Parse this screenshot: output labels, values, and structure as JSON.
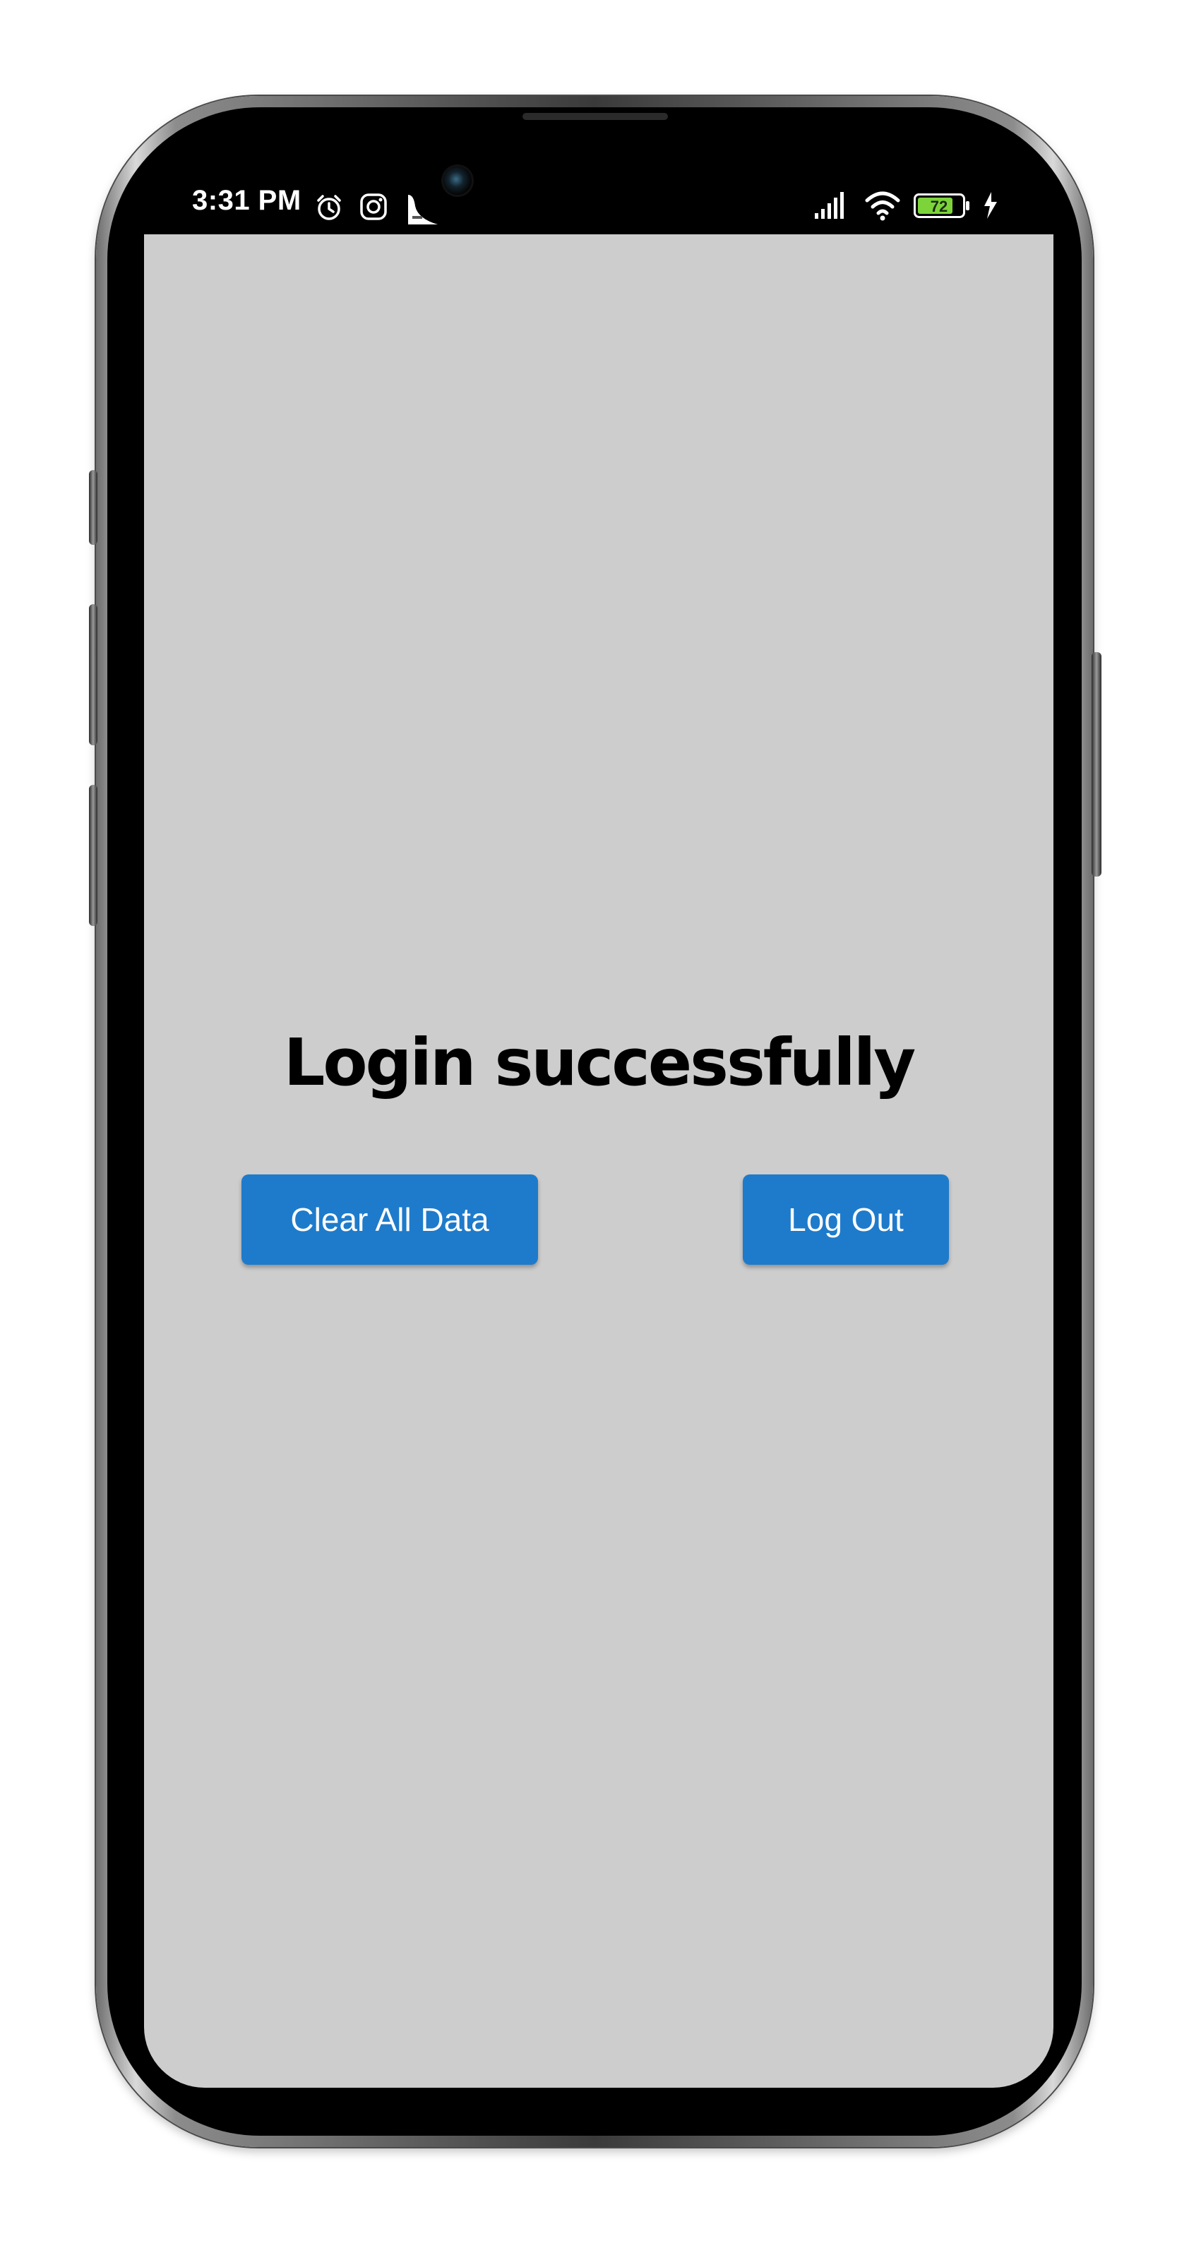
{
  "status_bar": {
    "time": "3:31 PM",
    "battery_level": "72",
    "icons": [
      "alarm-icon",
      "instagram-icon",
      "notification-icon",
      "signal-icon",
      "wifi-icon",
      "battery-icon",
      "charging-icon"
    ]
  },
  "screen": {
    "title": "Login successfully",
    "buttons": {
      "clear_all_data": "Clear All Data",
      "log_out": "Log Out"
    }
  },
  "colors": {
    "screen_background": "#cdcdcd",
    "button_background": "#1e7bcb",
    "button_text": "#ffffff",
    "title_text": "#000000",
    "battery_fill": "#7cd43a"
  }
}
